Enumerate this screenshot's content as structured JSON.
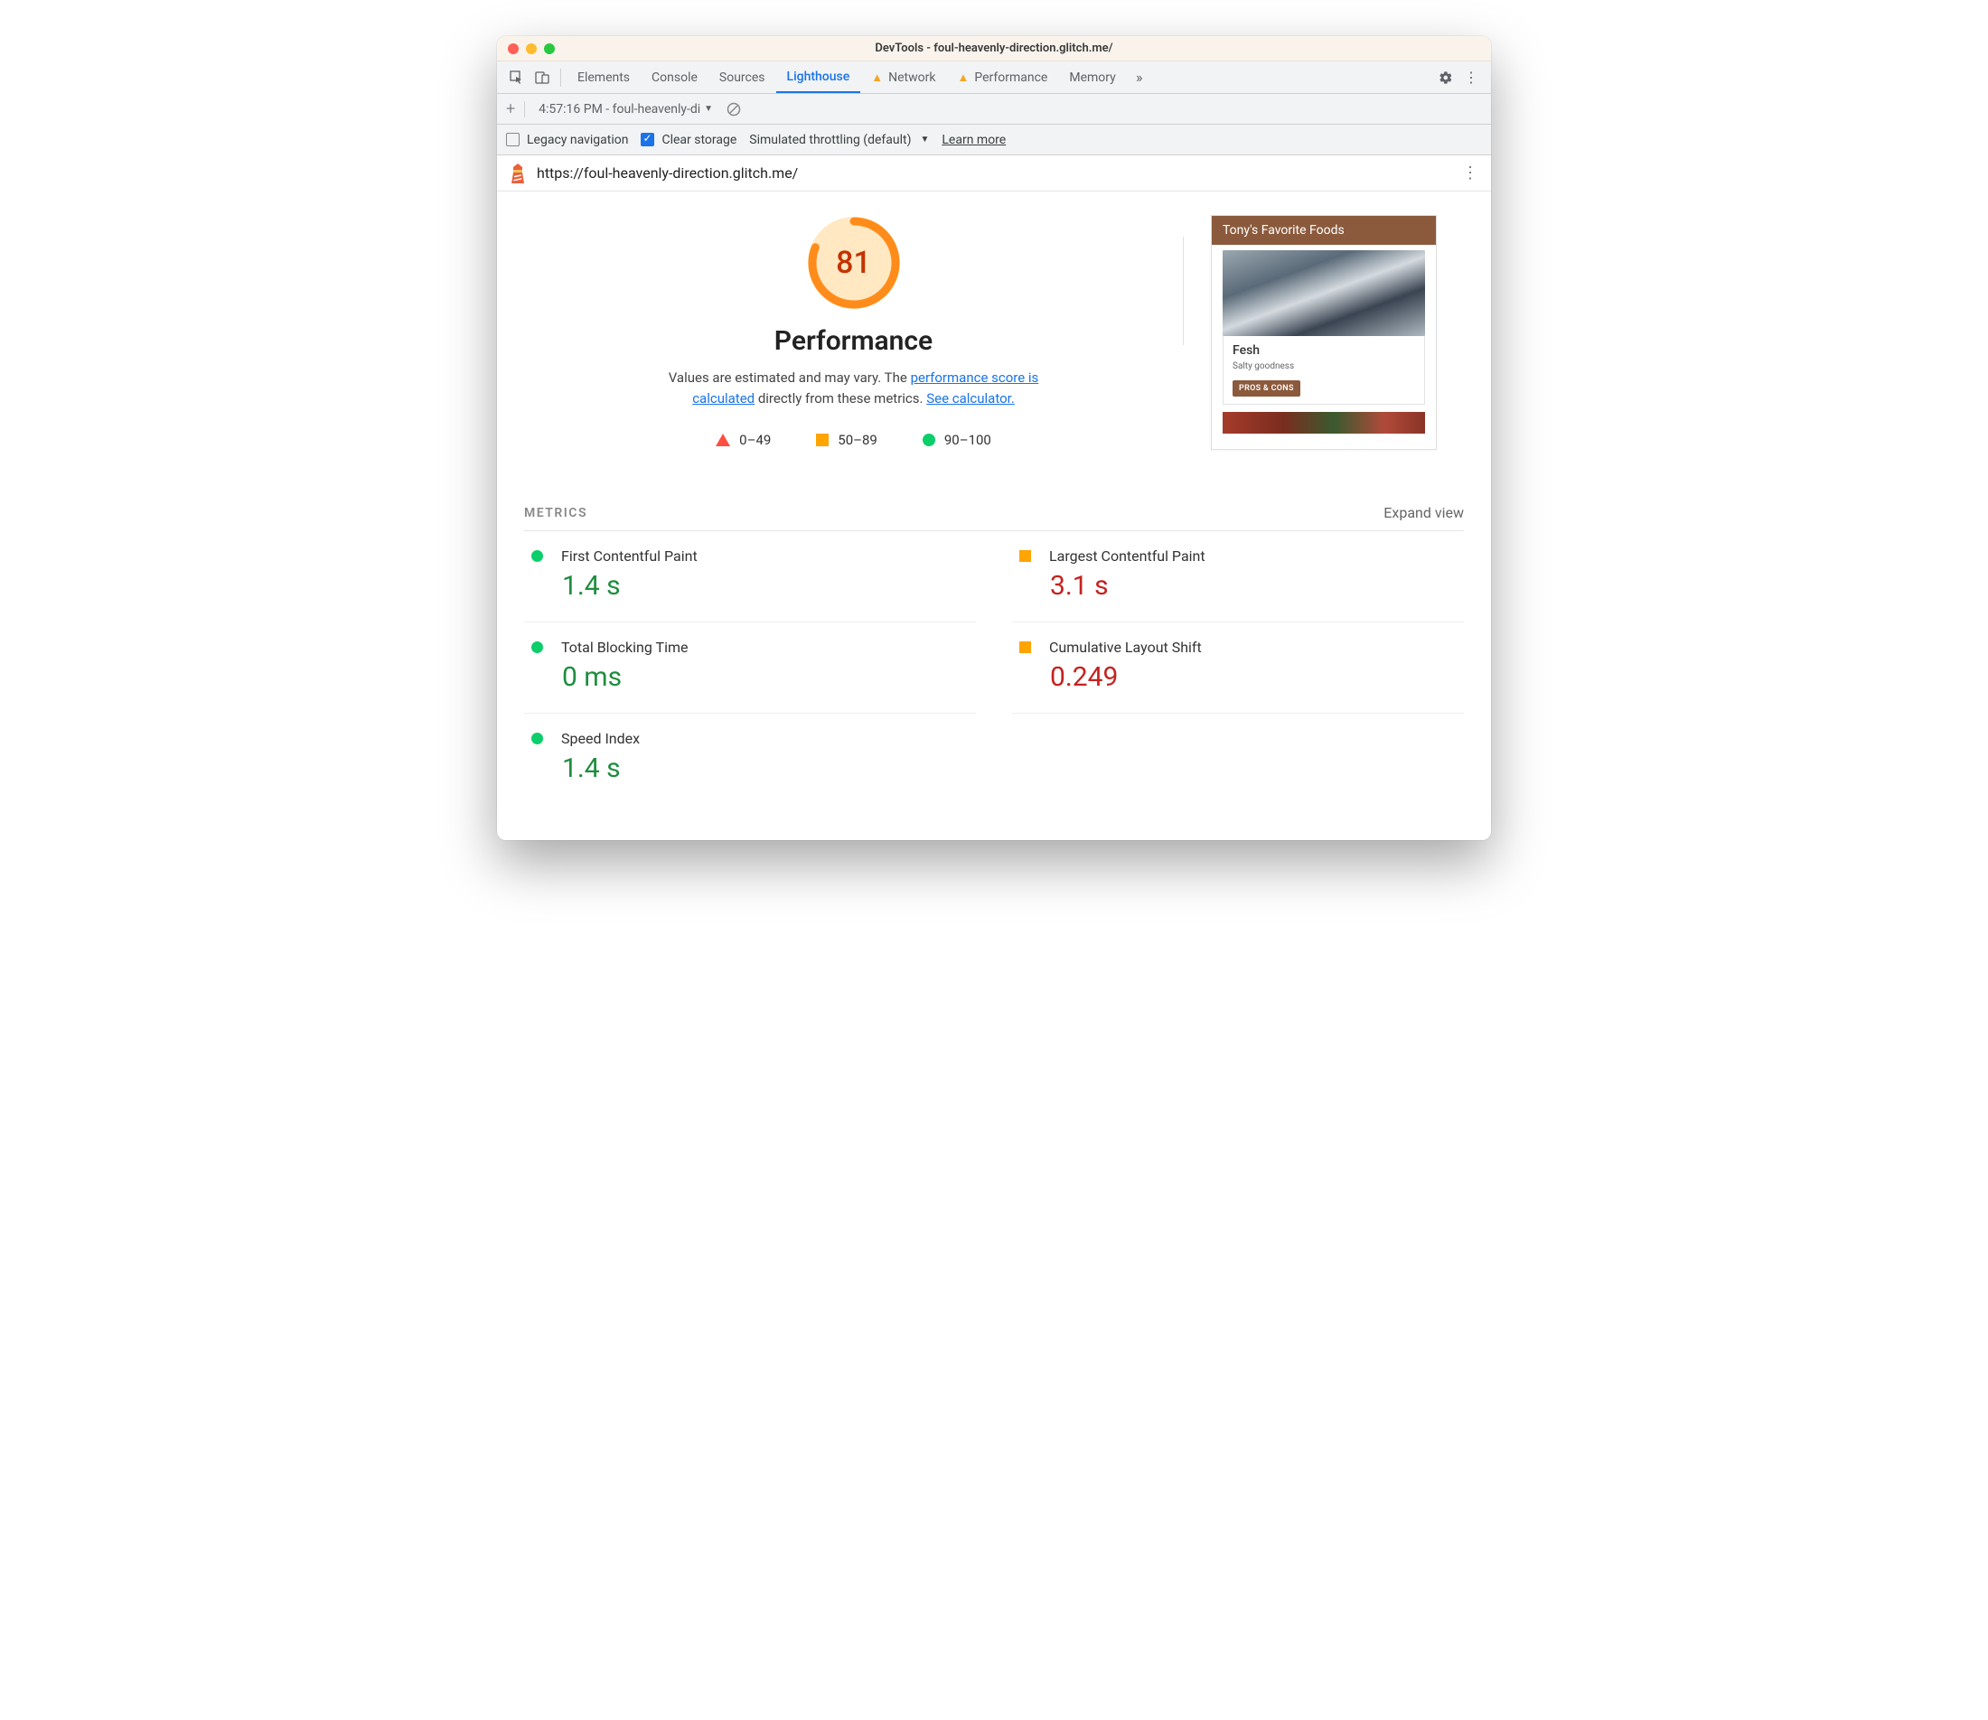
{
  "window": {
    "title": "DevTools - foul-heavenly-direction.glitch.me/"
  },
  "tabs": {
    "items": [
      "Elements",
      "Console",
      "Sources",
      "Lighthouse",
      "Network",
      "Performance",
      "Memory"
    ],
    "active": "Lighthouse",
    "warn": [
      "Network",
      "Performance"
    ]
  },
  "subbar": {
    "report_label": "4:57:16 PM - foul-heavenly-di"
  },
  "options": {
    "legacy_label": "Legacy navigation",
    "legacy_checked": false,
    "clear_label": "Clear storage",
    "clear_checked": true,
    "throttle_label": "Simulated throttling (default)",
    "learn_more": "Learn more"
  },
  "url": "https://foul-heavenly-direction.glitch.me/",
  "gauge": {
    "score": "81",
    "heading": "Performance"
  },
  "desc": {
    "pre": "Values are estimated and may vary. The ",
    "link1": "performance score is calculated",
    "mid": " directly from these metrics. ",
    "link2": "See calculator."
  },
  "legend": {
    "r1": "0–49",
    "r2": "50–89",
    "r3": "90–100"
  },
  "preview": {
    "header": "Tony's Favorite Foods",
    "item_name": "Fesh",
    "item_sub": "Salty goodness",
    "btn": "PROS & CONS"
  },
  "metrics_header": {
    "title": "METRICS",
    "expand": "Expand view"
  },
  "metrics": [
    {
      "label": "First Contentful Paint",
      "value": "1.4 s",
      "status": "green"
    },
    {
      "label": "Largest Contentful Paint",
      "value": "3.1 s",
      "status": "amber"
    },
    {
      "label": "Total Blocking Time",
      "value": "0 ms",
      "status": "green"
    },
    {
      "label": "Cumulative Layout Shift",
      "value": "0.249",
      "status": "amber"
    },
    {
      "label": "Speed Index",
      "value": "1.4 s",
      "status": "green"
    }
  ]
}
